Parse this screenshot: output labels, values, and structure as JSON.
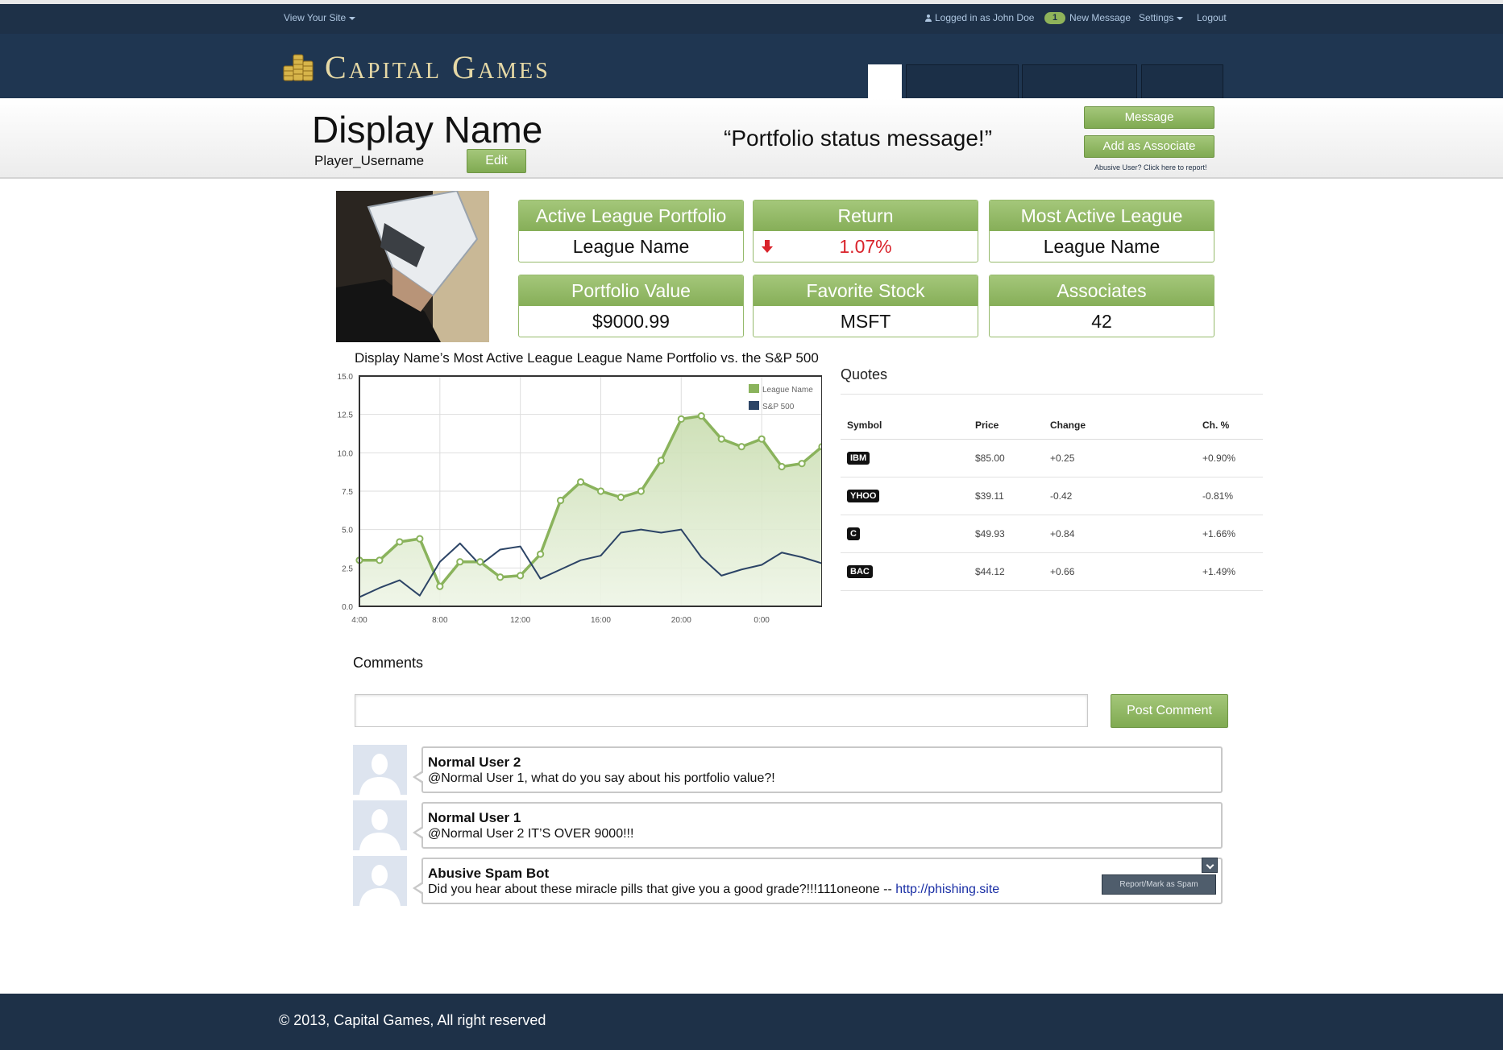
{
  "topbar": {
    "view_site": "View Your Site",
    "logged_in": "Logged in as John Doe",
    "message_count": "1",
    "new_message": "New Message",
    "settings": "Settings",
    "logout": "Logout"
  },
  "header": {
    "logo_text": "Capital Games",
    "logo_icon": "coins-icon"
  },
  "profile": {
    "display_name": "Display Name",
    "username": "Player_Username",
    "edit_label": "Edit",
    "status_message": "“Portfolio status message!”",
    "message_label": "Message",
    "add_associate_label": "Add as Associate",
    "report_text": "Abusive User? Click here to report!"
  },
  "stats": {
    "active_league_label": "Active League Portfolio",
    "active_league_value": "League Name",
    "return_label": "Return",
    "return_value": "1.07%",
    "return_icon": "down-arrow-icon",
    "most_active_label": "Most Active League",
    "most_active_value": "League Name",
    "portfolio_value_label": "Portfolio Value",
    "portfolio_value": "$9000.99",
    "favorite_stock_label": "Favorite Stock",
    "favorite_stock_value": "MSFT",
    "associates_label": "Associates",
    "associates_value": "42"
  },
  "colors": {
    "navy": "#1e3148",
    "green": "#8ab35c",
    "red": "#d9232b",
    "sp500_line": "#2c4466"
  },
  "chart_data": {
    "type": "area",
    "title": "Display Name’s Most Active League League Name Portfolio vs. the S&P 500",
    "x_tick_labels": [
      "4:00",
      "8:00",
      "12:00",
      "16:00",
      "20:00",
      "0:00"
    ],
    "xlim": [
      0,
      23
    ],
    "ylim": [
      0,
      15
    ],
    "y_ticks": [
      "0.0",
      "2.5",
      "5.0",
      "7.5",
      "10.0",
      "12.5",
      "15.0"
    ],
    "grid": true,
    "legend_position": "top-right",
    "series": [
      {
        "name": "League Name",
        "color": "#8ab35c",
        "x": [
          0,
          1,
          2,
          3,
          4,
          5,
          6,
          7,
          8,
          9,
          10,
          11,
          12,
          13,
          14,
          15,
          16,
          17,
          18,
          19,
          20,
          21,
          22,
          23
        ],
        "values": [
          3.0,
          3.0,
          4.2,
          4.4,
          1.3,
          2.9,
          2.9,
          1.9,
          2.0,
          3.4,
          6.9,
          8.1,
          7.5,
          7.1,
          7.5,
          9.5,
          12.2,
          12.4,
          10.9,
          10.4,
          10.9,
          9.1,
          9.3,
          10.4
        ]
      },
      {
        "name": "S&P 500",
        "color": "#2c4466",
        "x": [
          0,
          1,
          2,
          3,
          4,
          5,
          6,
          7,
          8,
          9,
          10,
          11,
          12,
          13,
          14,
          15,
          16,
          17,
          18,
          19,
          20,
          21,
          22,
          23
        ],
        "values": [
          0.6,
          1.2,
          1.7,
          0.7,
          2.9,
          4.1,
          2.7,
          3.7,
          3.9,
          1.8,
          2.4,
          3.0,
          3.3,
          4.8,
          5.0,
          4.8,
          5.0,
          3.2,
          2.0,
          2.4,
          2.7,
          3.5,
          3.2,
          2.8
        ]
      }
    ]
  },
  "quotes": {
    "title": "Quotes",
    "headers": [
      "Symbol",
      "Price",
      "Change",
      "Ch. %"
    ],
    "rows": [
      {
        "symbol": "IBM",
        "price": "$85.00",
        "change": "+0.25",
        "pct": "+0.90%",
        "dir": "up"
      },
      {
        "symbol": "YHOO",
        "price": "$39.11",
        "change": "-0.42",
        "pct": "-0.81%",
        "dir": "down"
      },
      {
        "symbol": "C",
        "price": "$49.93",
        "change": "+0.84",
        "pct": "+1.66%",
        "dir": "up"
      },
      {
        "symbol": "BAC",
        "price": "$44.12",
        "change": "+0.66",
        "pct": "+1.49%",
        "dir": "up"
      }
    ]
  },
  "comments": {
    "title": "Comments",
    "input_value": "",
    "post_label": "Post Comment",
    "items": [
      {
        "author": "Normal User 2",
        "text": "@Normal User 1, what do you say about his portfolio value?!"
      },
      {
        "author": "Normal User 1",
        "text": "@Normal User 2 IT’S OVER 9000!!!"
      },
      {
        "author": "Abusive Spam Bot",
        "text": "Did you hear about these miracle pills that give you a good grade?!!!111oneone  --",
        "link": "http://phishing.site"
      }
    ],
    "spam_menu_label": "Report/Mark as Spam"
  },
  "footer": {
    "text": "© 2013,  Capital Games, All right reserved"
  }
}
